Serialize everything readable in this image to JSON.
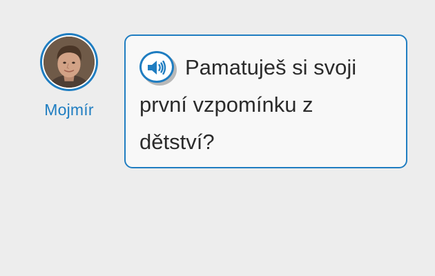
{
  "speaker": {
    "name": "Mojmír"
  },
  "bubble": {
    "text": "Pamatuješ si svoji první vzpomínku z dětství?"
  },
  "icons": {
    "audio": "speaker-icon",
    "avatar": "avatar-photo"
  },
  "colors": {
    "accent": "#1f7dc1",
    "background": "#ededed",
    "bubble_bg": "#f8f8f8",
    "text": "#2b2b2b"
  }
}
